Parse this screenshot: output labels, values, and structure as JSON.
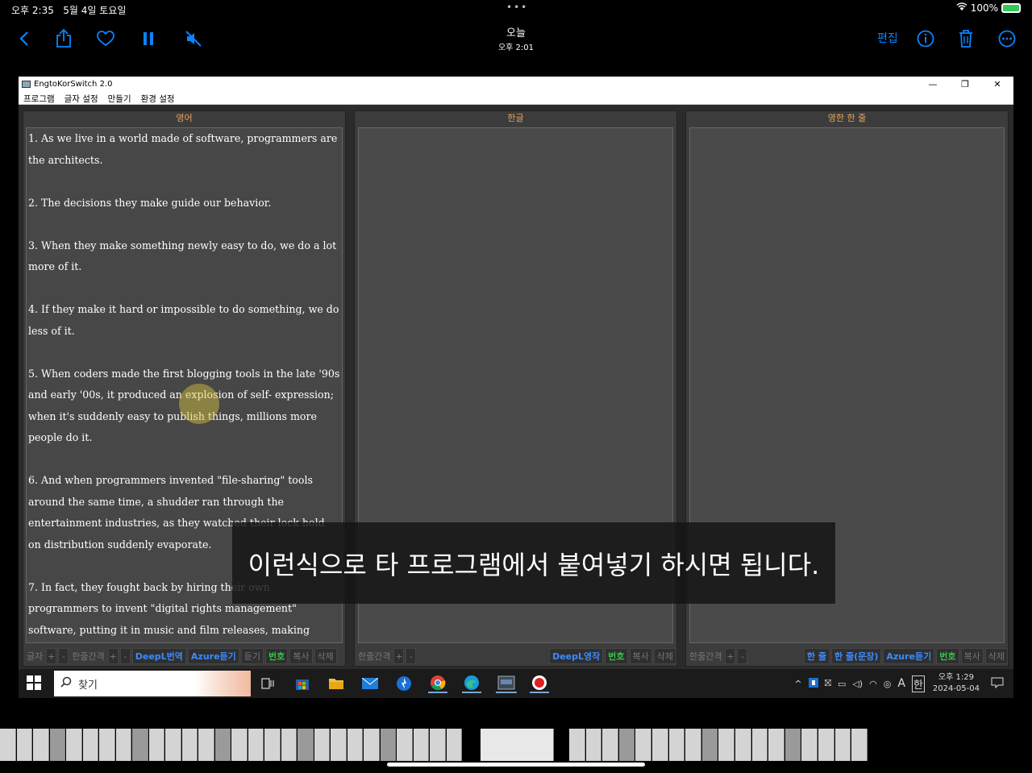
{
  "status_bar": {
    "time": "오후 2:35",
    "date": "5월 4일 토요일",
    "battery": "100%"
  },
  "toolbar": {
    "title": "오늘",
    "subtitle": "오후 2:01",
    "edit_label": "편집"
  },
  "window": {
    "title": "EngtoKorSwitch 2.0",
    "menu": [
      "프로그램",
      "글자 설정",
      "만들기",
      "환경 설정"
    ]
  },
  "panels": {
    "english": {
      "header": "영어",
      "paragraphs": [
        "1. As we live in a world made of software, programmers are the architects.",
        "2. The decisions they make guide our behavior.",
        "3. When they make something newly easy to do, we do a lot more of it.",
        "4. If they make it hard or impossible to do something, we do less of it.",
        "5. When coders made the first blogging tools in the late '90s and early '00s, it produced an explosion of self- expression; when it's suddenly easy to publish things, millions more people do it.",
        "6. And when programmers invented \"file-sharing\" tools around the same time, a shudder ran through the entertainment industries, as they watched their lock hold on distribution suddenly evaporate.",
        "7. In fact, they fought back by hiring their own programmers to invent \"digital rights management\" software, putting it in music and film releases, making"
      ],
      "buttons": {
        "font": "글자",
        "plus": "+",
        "minus": "-",
        "line_spacing": "한줄간격",
        "deepl": "DeepL번역",
        "azure": "Azure듣기",
        "listen": "듣기",
        "number": "번호",
        "copy": "복사",
        "delete": "삭제"
      }
    },
    "korean": {
      "header": "한글",
      "buttons": {
        "line_spacing": "한줄간격",
        "plus": "+",
        "minus": "-",
        "deepl": "DeepL영작",
        "number": "번호",
        "copy": "복사",
        "delete": "삭제"
      }
    },
    "bilingual": {
      "header": "영한 한 줄",
      "buttons": {
        "line_spacing": "한줄간격",
        "plus": "+",
        "minus": "-",
        "one_line": "한 줄",
        "one_line_sentence": "한 줄(문장)",
        "azure": "Azure듣기",
        "number": "번호",
        "copy": "복사",
        "delete": "삭제"
      }
    }
  },
  "subtitle": "이런식으로 타 프로그램에서 붙여넣기 하시면 됩니다.",
  "taskbar": {
    "search_placeholder": "찾기",
    "clock_time": "오후 1:29",
    "clock_date": "2024-05-04",
    "ime_label": "A",
    "ime_lang": "한"
  },
  "colors": {
    "accent": "#0a84ff",
    "panel_header": "#e8a25a",
    "button_blue": "#3b8bff",
    "button_green": "#36c24a"
  }
}
